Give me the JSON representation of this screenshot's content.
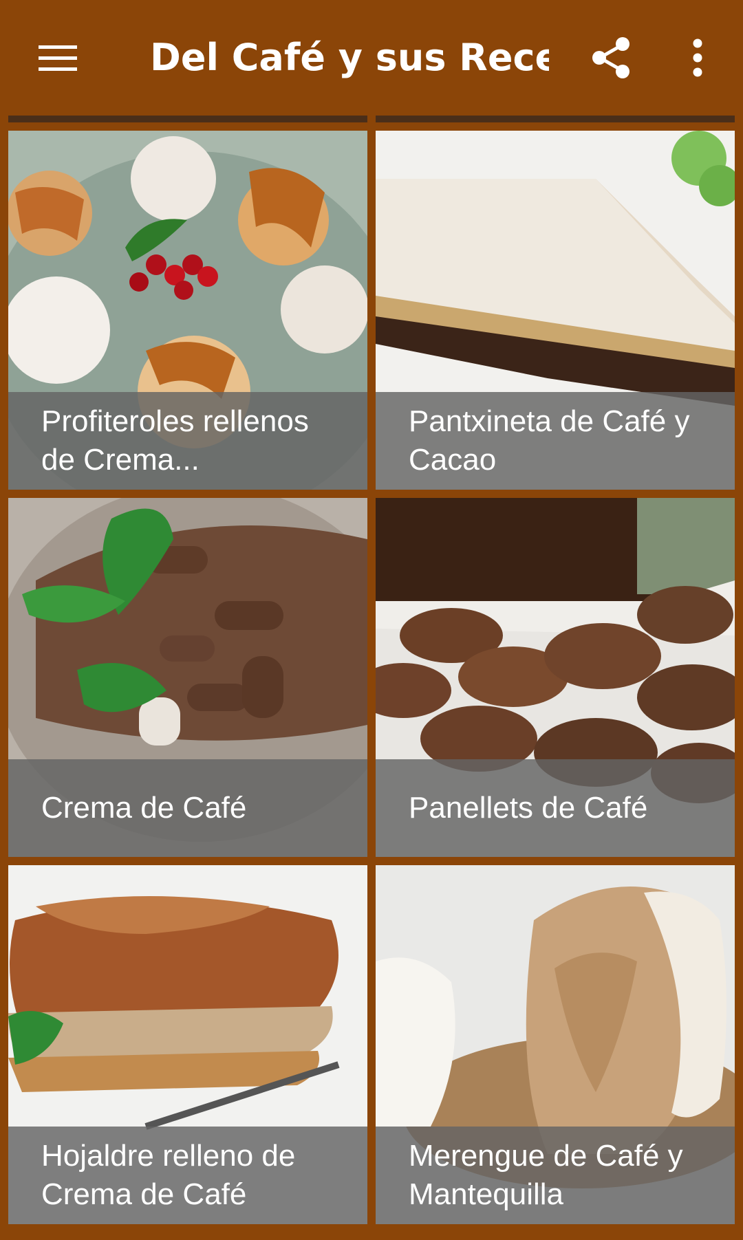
{
  "app_bar": {
    "title": "Del Café y sus Rece...",
    "menu_icon": "hamburger-menu-icon",
    "share_icon": "share-icon",
    "more_icon": "more-vert-icon"
  },
  "colors": {
    "primary": "#8B4508",
    "caption_overlay": "#646464",
    "text_on_primary": "#FFFFFF"
  },
  "recipes": [
    {
      "title": "Profiteroles rellenos de Crema..."
    },
    {
      "title": "Pantxineta de Café y Cacao"
    },
    {
      "title": "Crema de Café"
    },
    {
      "title": "Panellets de Café"
    },
    {
      "title": "Hojaldre relleno de Crema de Café"
    },
    {
      "title": "Merengue de Café y Mantequilla"
    }
  ]
}
